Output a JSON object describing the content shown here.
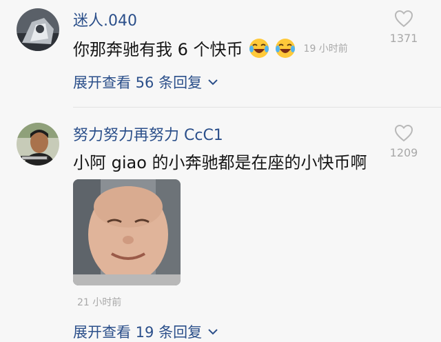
{
  "comments": [
    {
      "username": "迷人.040",
      "text": "你那奔驰有我 6 个快币",
      "time": "19 小时前",
      "likes": "1371",
      "expand_label": "展开查看 56 条回复"
    },
    {
      "username": "努力努力再努力 CcC1",
      "text": "小阿 giao 的小奔驰都是在座的小快币啊",
      "time": "21 小时前",
      "likes": "1209",
      "expand_label": "展开查看 19 条回复"
    }
  ],
  "icons": {
    "like": "heart-outline-icon",
    "expand": "chevron-down-icon",
    "emoji": "laughing-crying-emoji"
  },
  "colors": {
    "username": "#2b4f8a",
    "meta": "#a8a8a8",
    "background": "#f7f7f7"
  }
}
